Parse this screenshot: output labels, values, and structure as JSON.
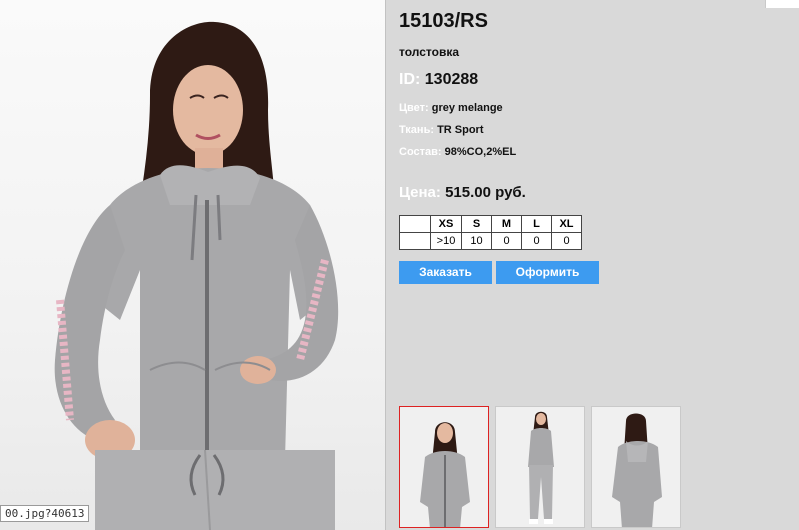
{
  "product": {
    "article": "15103/RS",
    "type": "толстовка",
    "id_label": "ID:",
    "id_value": "130288",
    "color_label": "Цвет:",
    "color_value": "grey melange",
    "fabric_label": "Ткань:",
    "fabric_value": "TR Sport",
    "composition_label": "Состав:",
    "composition_value": "98%CO,2%EL",
    "price_label": "Цена:",
    "price_value": "515.00 руб."
  },
  "sizes": {
    "headers": [
      "",
      "XS",
      "S",
      "M",
      "L",
      "XL"
    ],
    "stock": [
      "",
      ">10",
      "10",
      "0",
      "0",
      "0"
    ]
  },
  "buttons": {
    "order": "Заказать",
    "checkout": "Оформить"
  },
  "status_url": "00.jpg?40613",
  "thumbnails": [
    {
      "icon": "front-upper-thumbnail",
      "active": true
    },
    {
      "icon": "full-body-thumbnail",
      "active": false
    },
    {
      "icon": "back-view-thumbnail",
      "active": false
    }
  ],
  "colors": {
    "accent": "#3d9bf0",
    "panel": "#d9d9d9",
    "active_border": "#dd2222"
  }
}
